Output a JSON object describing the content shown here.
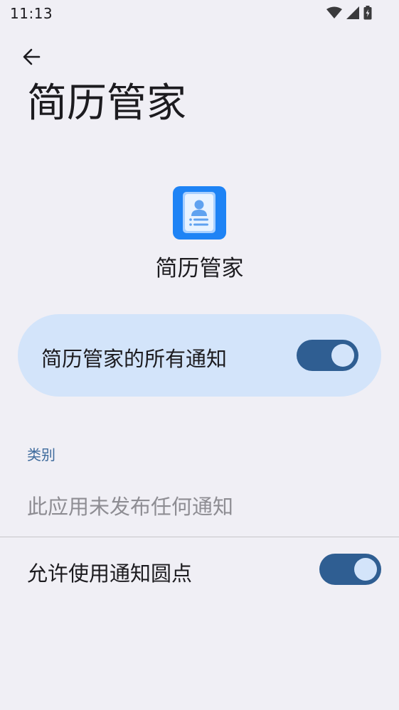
{
  "status_bar": {
    "time": "11:13",
    "icons": [
      "wifi-icon",
      "signal-icon",
      "battery-icon"
    ]
  },
  "header": {
    "back_icon": "arrow-left-icon",
    "title": "简历管家"
  },
  "app": {
    "name": "简历管家",
    "icon": "resume-contact-icon",
    "icon_color": "#1e83f5"
  },
  "main_toggle": {
    "label": "简历管家的所有通知",
    "enabled": true
  },
  "categories": {
    "header": "类别",
    "empty_text": "此应用未发布任何通知"
  },
  "notification_dot": {
    "label": "允许使用通知圆点",
    "enabled": true
  },
  "colors": {
    "background": "#f0eff5",
    "card": "#d3e4fa",
    "switch_track": "#2f5e92",
    "accent_text": "#3d6a9c"
  }
}
